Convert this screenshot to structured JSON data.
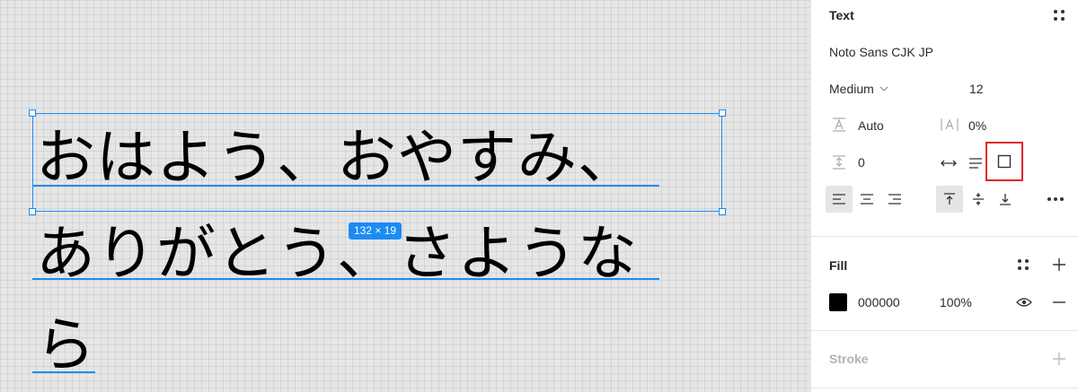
{
  "canvas": {
    "lines": [
      "おはよう、おやすみ、",
      "ありがとう、さようなら",
      "ら"
    ],
    "size_badge": "132 × 19",
    "selection_color": "#1b8cf2"
  },
  "text_section": {
    "title": "Text",
    "font_family": "Noto Sans CJK JP",
    "font_weight": "Medium",
    "font_size": "12",
    "line_height": "Auto",
    "letter_spacing": "0%",
    "paragraph_spacing": "0"
  },
  "fill_section": {
    "title": "Fill",
    "color_hex": "000000",
    "opacity": "100%"
  },
  "stroke_section": {
    "title": "Stroke"
  },
  "colors": {
    "accent": "#1b8cf2",
    "highlight": "#e0262d"
  }
}
